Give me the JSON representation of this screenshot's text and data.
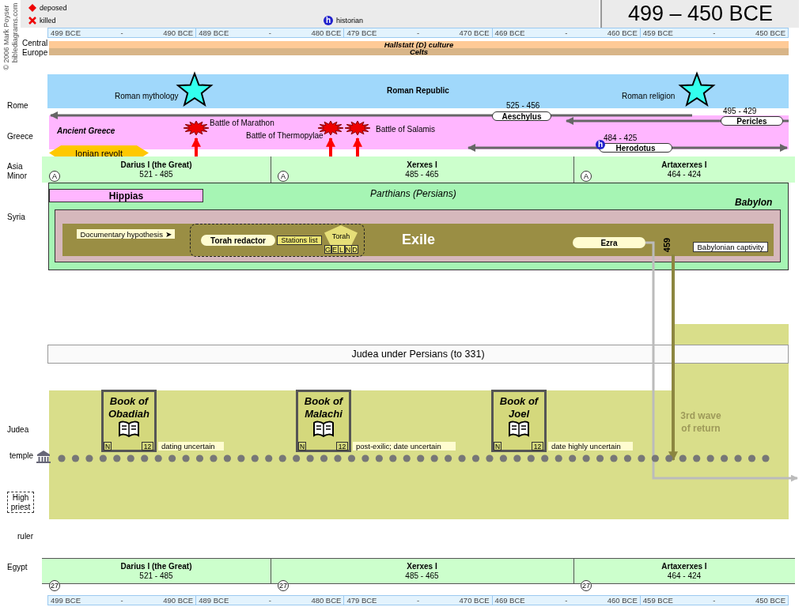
{
  "credit": [
    "© 2006 Mark Poyser",
    "biblediagrams.com"
  ],
  "legend": [
    {
      "kind": "deposed",
      "label": "deposed"
    },
    {
      "kind": "killed",
      "label": "killed"
    },
    {
      "kind": "historian",
      "symbol": "h",
      "label": "historian"
    }
  ],
  "title": "499 – 450 BCE",
  "timescale_top": [
    [
      "499 BCE",
      "-",
      "490 BCE"
    ],
    [
      "489 BCE",
      "-",
      "480 BCE"
    ],
    [
      "479 BCE",
      "-",
      "470 BCE"
    ],
    [
      "469 BCE",
      "-",
      "460 BCE"
    ],
    [
      "459 BCE",
      "-",
      "450 BCE"
    ]
  ],
  "row_labels": [
    "Central Europe",
    "Rome",
    "Greece",
    "Asia Minor",
    "Syria",
    "Judea",
    "temple",
    "High priest",
    "ruler",
    "Egypt"
  ],
  "central_europe": {
    "culture": "Hallstatt (D) culture",
    "people": "Celts"
  },
  "rome": {
    "name": "Roman Republic",
    "notes": [
      "Roman mythology",
      "Roman religion"
    ]
  },
  "people": [
    {
      "name": "Aeschylus",
      "dates": "525 - 456"
    },
    {
      "name": "Pericles",
      "dates": "495 - 429"
    },
    {
      "name": "Herodotus",
      "dates": "484 - 425",
      "symbol": "h"
    }
  ],
  "greece": {
    "name": "Ancient Greece",
    "revolt": "Ionian revolt",
    "battles": [
      "Battle of Marathon",
      "Battle of Thermopylae",
      "Battle of Salamis"
    ]
  },
  "rulers_asia_minor": [
    {
      "name": "Darius I (the Great)",
      "dates": "521 - 485",
      "ref": "A"
    },
    {
      "name": "Xerxes I",
      "dates": "485 - 465",
      "ref": "A"
    },
    {
      "name": "Artaxerxes I",
      "dates": "464 - 424",
      "ref": "A"
    }
  ],
  "syria": {
    "hippias": "Hippias",
    "empire": "Parthians (Persians)",
    "place": "Babylon",
    "documentary": "Documentary hypothesis ➤",
    "redactor": "Torah redactor",
    "stations": "Stations list",
    "torah": "Torah",
    "sources": [
      "G",
      "E",
      "L",
      "N",
      "D"
    ],
    "exile": "Exile",
    "ezra": "Ezra",
    "year": "459",
    "captivity": "Babylonian captivity"
  },
  "judea": {
    "period": "Judea under Persians (to 331)",
    "return_note": "3rd wave of return",
    "books": [
      {
        "title": "Book of Obadiah",
        "tags": [
          "N",
          "12"
        ],
        "note": "dating uncertain"
      },
      {
        "title": "Book of Malachi",
        "tags": [
          "N",
          "12"
        ],
        "note": "post-exilic; date uncertain"
      },
      {
        "title": "Book of Joel",
        "tags": [
          "N",
          "12"
        ],
        "note": "date highly uncertain"
      }
    ]
  },
  "rulers_egypt": [
    {
      "name": "Darius I (the Great)",
      "dates": "521 - 485",
      "ref": "27"
    },
    {
      "name": "Xerxes I",
      "dates": "485 - 465",
      "ref": "27"
    },
    {
      "name": "Artaxerxes I",
      "dates": "464 - 424",
      "ref": "27"
    }
  ],
  "timescale_bottom": [
    [
      "499 BCE",
      "-",
      "490 BCE"
    ],
    [
      "489 BCE",
      "-",
      "480 BCE"
    ],
    [
      "479 BCE",
      "-",
      "470 BCE"
    ],
    [
      "469 BCE",
      "-",
      "460 BCE"
    ],
    [
      "459 BCE",
      "-",
      "450 BCE"
    ]
  ]
}
